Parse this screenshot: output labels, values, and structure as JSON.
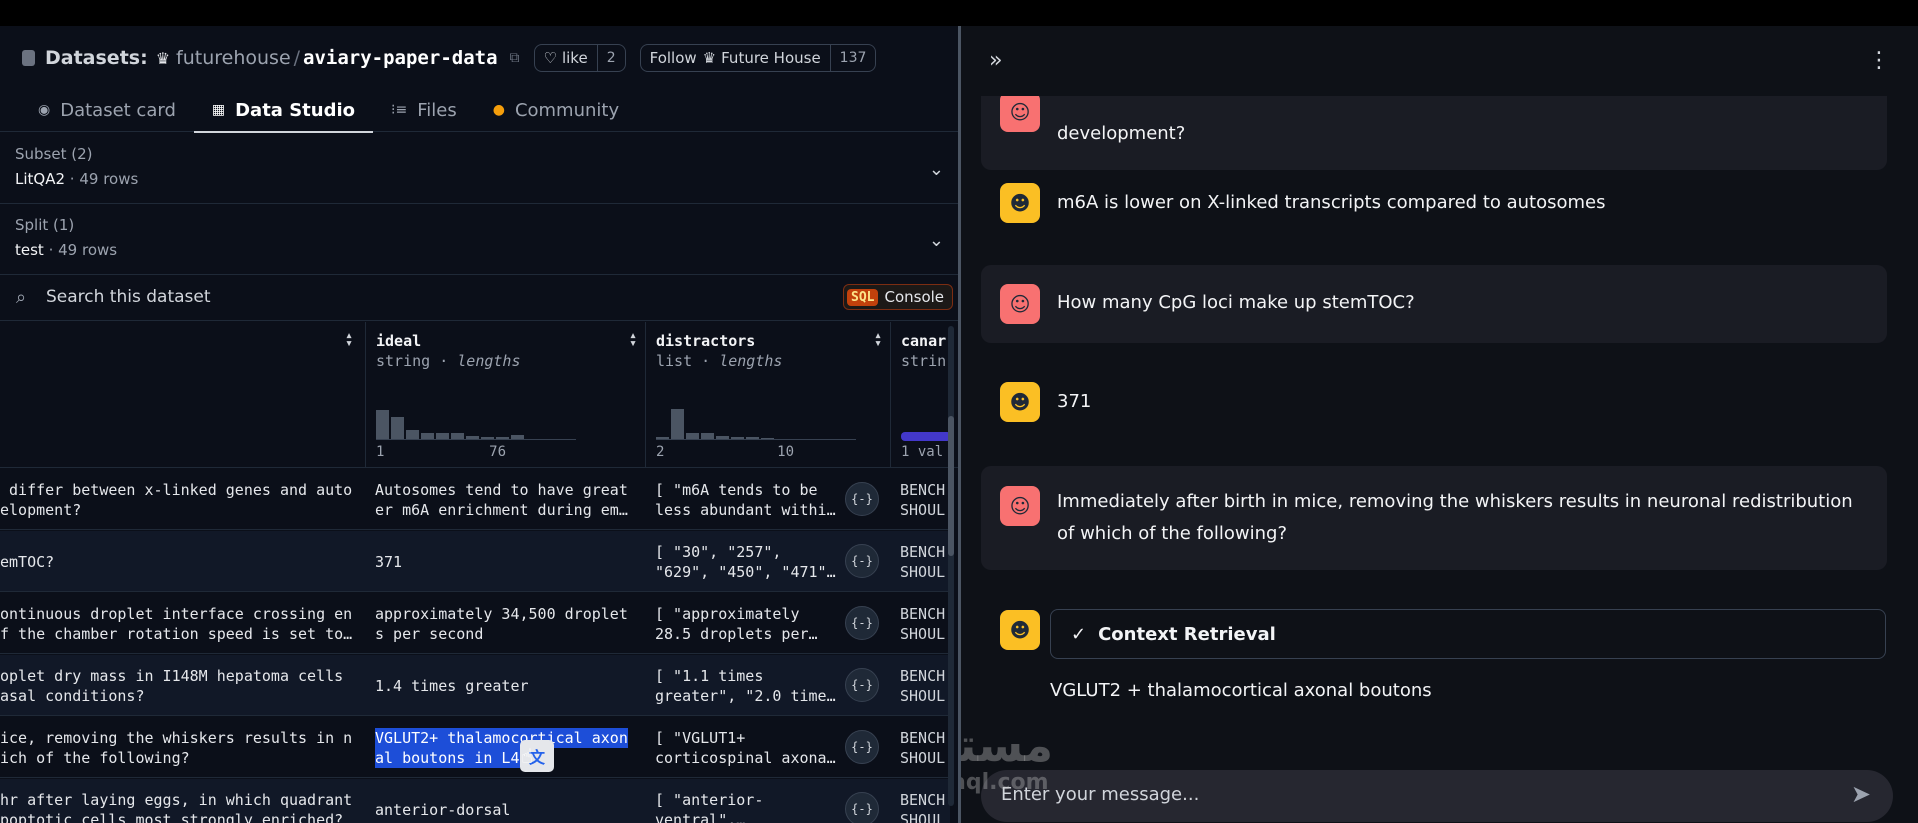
{
  "header": {
    "datasets_label": "Datasets:",
    "org": "futurehouse",
    "separator": "/",
    "repo": "aviary-paper-data",
    "like_label": "like",
    "like_count": "2",
    "follow_label": "Follow",
    "follow_org": "Future House",
    "follow_count": "137"
  },
  "tabs": [
    {
      "label": "Dataset card",
      "icon": "dataset-card-icon"
    },
    {
      "label": "Data Studio",
      "icon": "table-icon",
      "active": true
    },
    {
      "label": "Files",
      "icon": "files-icon"
    },
    {
      "label": "Community",
      "icon": "community-icon"
    }
  ],
  "subset": {
    "title": "Subset (2)",
    "value": "LitQA2",
    "rows": "49 rows"
  },
  "split": {
    "title": "Split (1)",
    "value": "test",
    "rows": "49 rows"
  },
  "search": {
    "placeholder": "Search this dataset",
    "sql_badge": "SQL",
    "sql_label": "Console"
  },
  "columns": [
    {
      "name": "ideal",
      "type": "string",
      "stat": "lengths",
      "min": "1",
      "max": "76",
      "hist": [
        0.9,
        0.7,
        0.28,
        0.18,
        0.18,
        0.2,
        0.08,
        0.05,
        0.05,
        0.12
      ]
    },
    {
      "name": "distractors",
      "type": "list",
      "stat": "lengths",
      "min": "2",
      "max": "10",
      "hist": [
        0.05,
        0.95,
        0.2,
        0.18,
        0.1,
        0.06,
        0.05,
        0.04,
        0.0
      ]
    },
    {
      "name": "canar",
      "type": "strin",
      "stat": "1 val"
    }
  ],
  "rows": [
    {
      "question": " differ between x-linked genes and auto\nelopment?",
      "ideal": "Autosomes tend to have great\ner m6A enrichment during em…",
      "distractors": "[ \"m6A tends to be\nless abundant withi…",
      "canary": "BENCH\nSHOUL"
    },
    {
      "question": "emTOC?",
      "ideal": "371",
      "distractors": "[ \"30\", \"257\",\n\"629\", \"450\", \"471\"…",
      "canary": "BENCH\nSHOUL"
    },
    {
      "question": "ontinuous droplet interface crossing en\nf the chamber rotation speed is set to…",
      "ideal": "approximately 34,500 droplet\ns per second",
      "distractors": "[ \"approximately\n28.5 droplets per…",
      "canary": "BENCH\nSHOUL"
    },
    {
      "question": "oplet dry mass in I148M hepatoma cells\nasal conditions?",
      "ideal": "1.4 times greater",
      "distractors": "[ \"1.1 times\ngreater\", \"2.0 time…",
      "canary": "BENCH\nSHOUL"
    },
    {
      "question": "ice, removing the whiskers results in n\nich of the following?",
      "ideal_line1": "VGLUT2+ thalamocortical axon",
      "ideal_line2": "al boutons in L4",
      "distractors": "[ \"VGLUT1+\ncorticospinal axona…",
      "canary": "BENCH\nSHOUL"
    },
    {
      "question": "hr after laying eggs, in which quadrant\npoptotic cells most strongly enriched?",
      "ideal": "anterior-dorsal",
      "distractors": "[ \"anterior-\nventral\",…",
      "canary": "BENCH\nSHOUL"
    }
  ],
  "json_button": "{-}",
  "chat": {
    "messages": [
      {
        "role": "user",
        "text": "development?"
      },
      {
        "role": "assistant",
        "text": "m6A is lower on X-linked transcripts compared to autosomes"
      },
      {
        "role": "user",
        "text": "How many CpG loci make up stemTOC?"
      },
      {
        "role": "assistant",
        "text": "371"
      },
      {
        "role": "user",
        "text": "Immediately after birth in mice, removing the whiskers results in neuronal redistribution of which of the following?"
      }
    ],
    "context_label": "Context Retrieval",
    "final_answer": "VGLUT2 + thalamocortical axonal boutons",
    "input_placeholder": "Enter your message..."
  },
  "watermark": {
    "arabic": "مستقل",
    "latin": "mostaql.com"
  },
  "colors": {
    "accent_sql": "#c2410c",
    "highlight": "#1d4ed8",
    "bot_avatar": "#fbbf24",
    "user_avatar": "#f87171"
  }
}
